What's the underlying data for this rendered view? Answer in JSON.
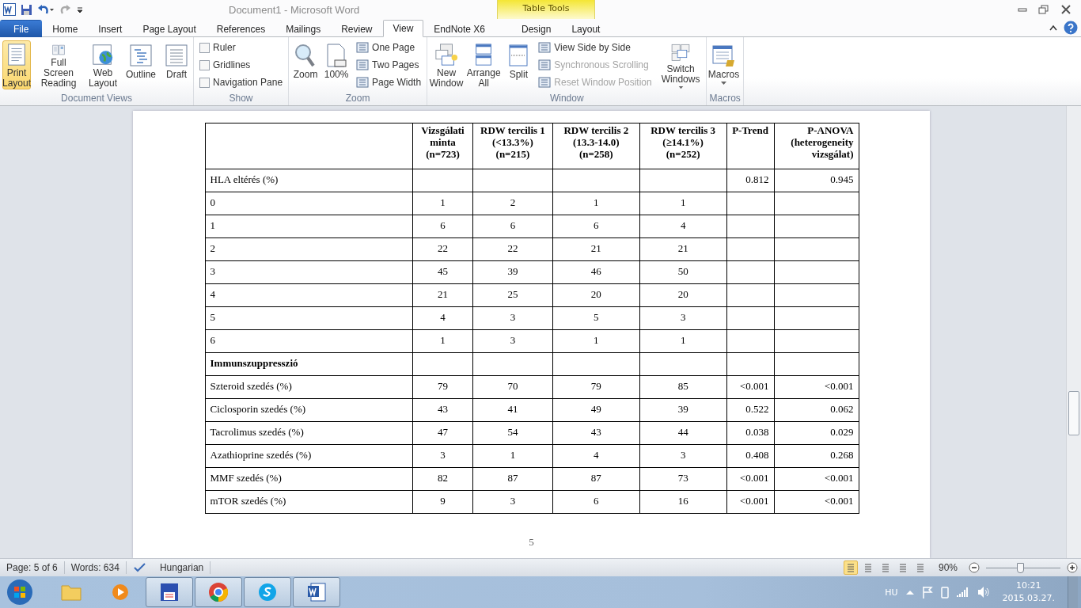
{
  "window": {
    "title": "Document1  -  Microsoft Word",
    "contextual_group": "Table Tools"
  },
  "tabs": [
    {
      "label": "File",
      "kind": "file",
      "selected": false
    },
    {
      "label": "Home",
      "kind": "normal",
      "selected": false
    },
    {
      "label": "Insert",
      "kind": "normal",
      "selected": false
    },
    {
      "label": "Page Layout",
      "kind": "normal",
      "selected": false
    },
    {
      "label": "References",
      "kind": "normal",
      "selected": false
    },
    {
      "label": "Mailings",
      "kind": "normal",
      "selected": false
    },
    {
      "label": "Review",
      "kind": "normal",
      "selected": false
    },
    {
      "label": "View",
      "kind": "normal",
      "selected": true
    },
    {
      "label": "EndNote X6",
      "kind": "normal",
      "selected": false
    },
    {
      "label": "Design",
      "kind": "contextual",
      "selected": false
    },
    {
      "label": "Layout",
      "kind": "contextual",
      "selected": false
    }
  ],
  "ribbon": {
    "groups": [
      {
        "name": "Document Views",
        "items": [
          {
            "kind": "large",
            "label": "Print Layout",
            "selected": true
          },
          {
            "kind": "large",
            "label": "Full Screen Reading",
            "selected": false
          },
          {
            "kind": "large",
            "label": "Web Layout",
            "selected": false
          },
          {
            "kind": "large",
            "label": "Outline",
            "selected": false
          },
          {
            "kind": "large",
            "label": "Draft",
            "selected": false
          }
        ]
      },
      {
        "name": "Show",
        "items": [
          {
            "kind": "checkbox",
            "label": "Ruler",
            "checked": false
          },
          {
            "kind": "checkbox",
            "label": "Gridlines",
            "checked": false
          },
          {
            "kind": "checkbox",
            "label": "Navigation Pane",
            "checked": false
          }
        ]
      },
      {
        "name": "Zoom",
        "items": [
          {
            "kind": "large",
            "label": "Zoom"
          },
          {
            "kind": "large",
            "label": "100%"
          },
          {
            "kind": "small",
            "label": "One Page"
          },
          {
            "kind": "small",
            "label": "Two Pages"
          },
          {
            "kind": "small",
            "label": "Page Width"
          }
        ]
      },
      {
        "name": "Window",
        "items": [
          {
            "kind": "large",
            "label": "New Window",
            "disabled": false
          },
          {
            "kind": "large",
            "label": "Arrange All",
            "disabled": false
          },
          {
            "kind": "large",
            "label": "Split",
            "disabled": false
          },
          {
            "kind": "small",
            "label": "View Side by Side",
            "disabled": false
          },
          {
            "kind": "small",
            "label": "Synchronous Scrolling",
            "disabled": true
          },
          {
            "kind": "small",
            "label": "Reset Window Position",
            "disabled": true
          },
          {
            "kind": "dropdown",
            "label": "Switch Windows",
            "disabled": false
          }
        ]
      },
      {
        "name": "Macros",
        "items": [
          {
            "kind": "dropdown",
            "label": "Macros"
          }
        ]
      }
    ]
  },
  "table": {
    "columns": [
      "Vizsgálati minta (n=723)",
      "RDW tercilis 1 (<13.3%) (n=215)",
      "RDW tercilis 2 (13.3-14.0) (n=258)",
      "RDW tercilis 3 (≥14.1%) (n=252)",
      "P-Trend",
      "P-ANOVA (heterogeneity vizsgálat)"
    ],
    "rows": [
      {
        "kind": "item",
        "label": "HLA eltérés (%)",
        "cells": [
          null,
          null,
          null,
          null,
          "0.812",
          "0.945"
        ]
      },
      {
        "kind": "item",
        "label": "0",
        "cells": [
          "1",
          "2",
          "1",
          "1",
          null,
          null
        ]
      },
      {
        "kind": "item",
        "label": "1",
        "cells": [
          "6",
          "6",
          "6",
          "4",
          null,
          null
        ]
      },
      {
        "kind": "item",
        "label": "2",
        "cells": [
          "22",
          "22",
          "21",
          "21",
          null,
          null
        ]
      },
      {
        "kind": "item",
        "label": "3",
        "cells": [
          "45",
          "39",
          "46",
          "50",
          null,
          null
        ]
      },
      {
        "kind": "item",
        "label": "4",
        "cells": [
          "21",
          "25",
          "20",
          "20",
          null,
          null
        ]
      },
      {
        "kind": "item",
        "label": "5",
        "cells": [
          "4",
          "3",
          "5",
          "3",
          null,
          null
        ]
      },
      {
        "kind": "item",
        "label": "6",
        "cells": [
          "1",
          "3",
          "1",
          "1",
          null,
          null
        ]
      },
      {
        "kind": "section",
        "label": "Immunszuppresszió",
        "cells": [
          null,
          null,
          null,
          null,
          null,
          null
        ]
      },
      {
        "kind": "item",
        "label": "Szteroid szedés (%)",
        "cells": [
          "79",
          "70",
          "79",
          "85",
          "<0.001",
          "<0.001"
        ]
      },
      {
        "kind": "item",
        "label": "Ciclosporin szedés (%)",
        "cells": [
          "43",
          "41",
          "49",
          "39",
          "0.522",
          "0.062"
        ]
      },
      {
        "kind": "item",
        "label": "Tacrolimus szedés (%)",
        "cells": [
          "47",
          "54",
          "43",
          "44",
          "0.038",
          "0.029"
        ]
      },
      {
        "kind": "item",
        "label": "Azathioprine szedés (%)",
        "cells": [
          "3",
          "1",
          "4",
          "3",
          "0.408",
          "0.268"
        ]
      },
      {
        "kind": "item",
        "label": "MMF szedés (%)",
        "cells": [
          "82",
          "87",
          "87",
          "73",
          "<0.001",
          "<0.001"
        ]
      },
      {
        "kind": "item",
        "label": "mTOR szedés (%)",
        "cells": [
          "9",
          "3",
          "6",
          "16",
          "<0.001",
          "<0.001"
        ]
      }
    ]
  },
  "page_number": "5",
  "status_bar": {
    "page": "Page: 5 of 6",
    "words": "Words: 634",
    "language": "Hungarian",
    "view_buttons": [
      {
        "selected": true
      },
      {
        "selected": false
      },
      {
        "selected": false
      },
      {
        "selected": false
      },
      {
        "selected": false
      }
    ],
    "zoom": "90%",
    "zoom_slider": {
      "level": 0.45
    }
  },
  "taskbar": {
    "apps": [
      {
        "running": false
      },
      {
        "running": false
      },
      {
        "running": true
      },
      {
        "running": true
      },
      {
        "running": true
      },
      {
        "running": true
      }
    ],
    "language": "HU",
    "time": "10:21",
    "date": "2015.03.27."
  }
}
